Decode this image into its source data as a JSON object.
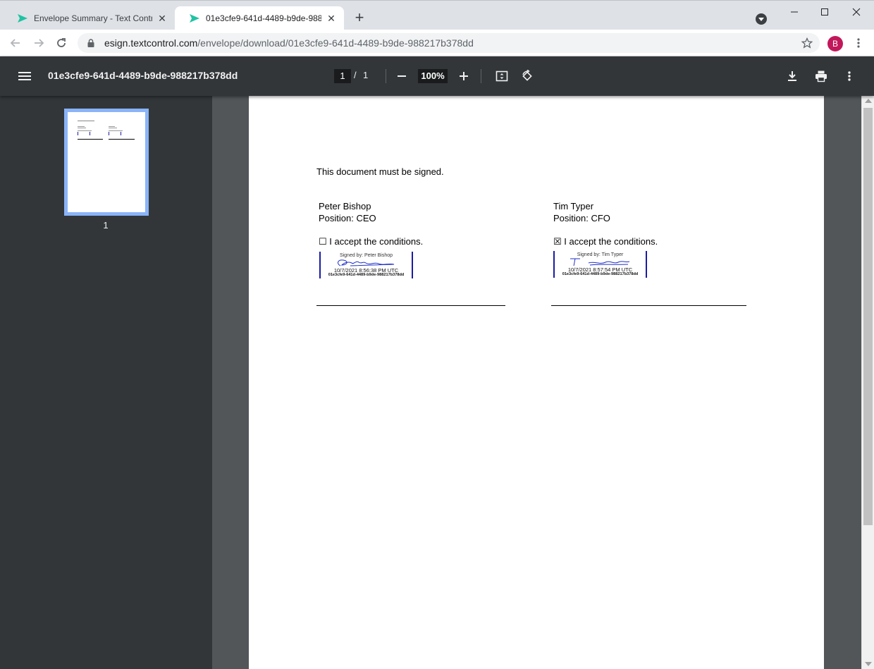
{
  "browser": {
    "tabs": [
      {
        "title": "Envelope Summary - Text Control",
        "active": false
      },
      {
        "title": "01e3cfe9-641d-4489-b9de-988217b378dd",
        "active": true
      }
    ],
    "new_tab_label": "+",
    "url_host": "esign.textcontrol.com",
    "url_path": "/envelope/download/01e3cfe9-641d-4489-b9de-988217b378dd",
    "profile_initial": "B",
    "accent_color": "#1fc3a3"
  },
  "pdf_toolbar": {
    "document_title": "01e3cfe9-641d-4489-b9de-988217b378dd",
    "current_page": "1",
    "page_separator": "/",
    "total_pages": "1",
    "zoom": "100%"
  },
  "sidebar": {
    "thumbnail_page_label": "1"
  },
  "document": {
    "intro": "This document must be signed.",
    "signers": [
      {
        "name": "Peter Bishop",
        "position": "Position: CEO",
        "acceptance": "☐ I accept the conditions.",
        "signed_by": "Signed by: Peter Bishop",
        "timestamp": "10/7/2021 8:56:38 PM UTC",
        "envelope_id": "01e3cfe9-641d-4489-b9de-988217b378dd"
      },
      {
        "name": "Tim Typer",
        "position": "Position: CFO",
        "acceptance": "☒ I accept the conditions.",
        "signed_by": "Signed by: Tim Typer",
        "timestamp": "10/7/2021 8:57:54 PM UTC",
        "envelope_id": "01e3cfe9-641d-4489-b9de-988217b378dd"
      }
    ]
  }
}
